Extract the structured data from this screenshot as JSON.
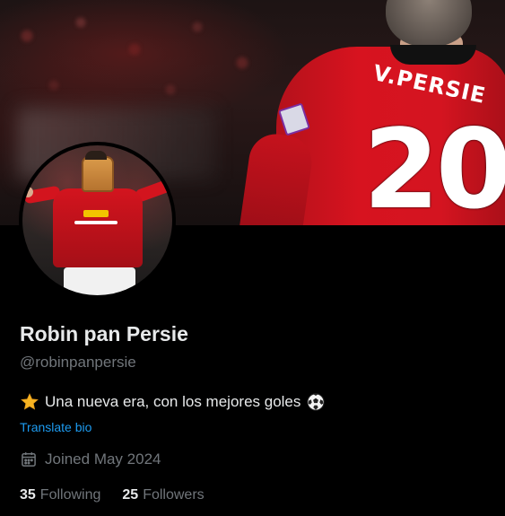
{
  "banner": {
    "shirt_name": "V.PERSIE",
    "shirt_number": "20"
  },
  "profile": {
    "display_name": "Robin pan Persie",
    "handle": "@robinpanpersie",
    "bio_text": "Una nueva era, con los mejores goles",
    "bio_icons": [
      "star-icon",
      "soccer-ball-icon"
    ],
    "translate_label": "Translate bio",
    "joined": "Joined May 2024",
    "joined_icon": "calendar-icon"
  },
  "stats": {
    "following_count": "35",
    "following_label": "Following",
    "followers_count": "25",
    "followers_label": "Followers"
  },
  "colors": {
    "background": "#000000",
    "text_primary": "#e7e9ea",
    "text_secondary": "#71767b",
    "link": "#1d9bf0",
    "shirt_red": "#d7131f"
  }
}
